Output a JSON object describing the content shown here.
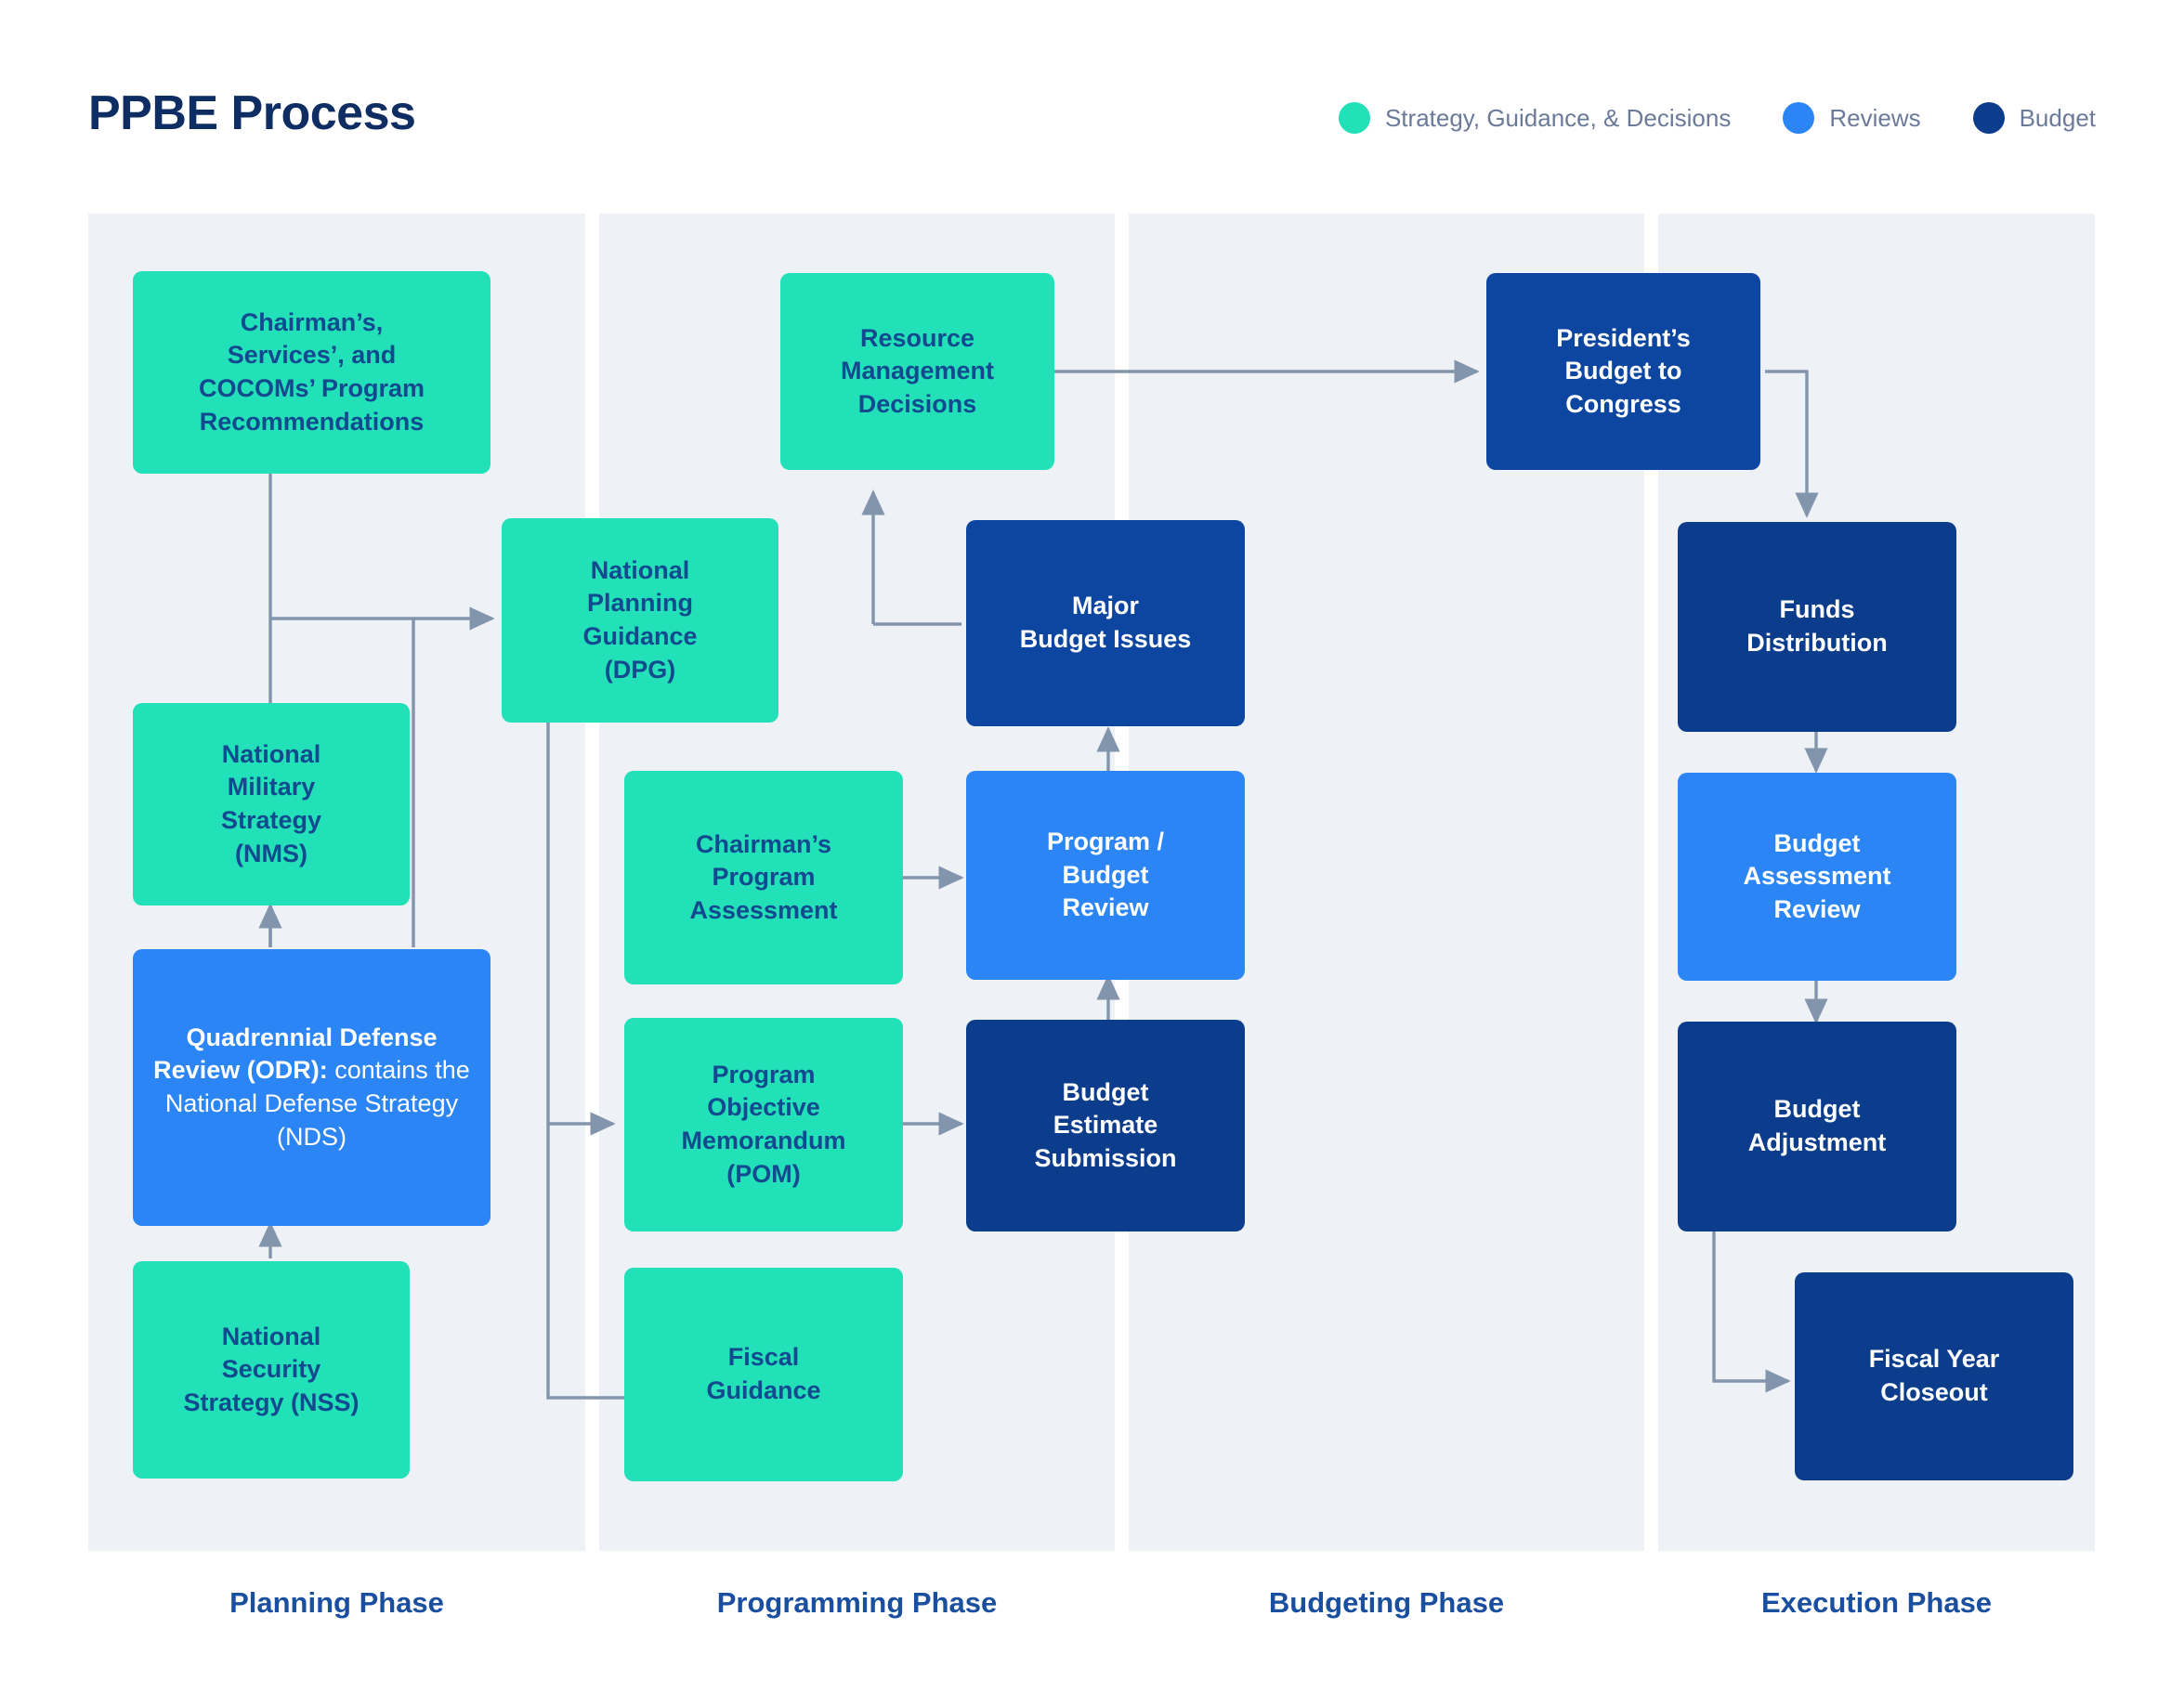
{
  "header": {
    "title": "PPBE Process",
    "legend": [
      {
        "label": "Strategy, Guidance, & Decisions",
        "color": "#22e0b8",
        "icon": "circle-icon"
      },
      {
        "label": "Reviews",
        "color": "#2b85f5",
        "icon": "circle-icon"
      },
      {
        "label": "Budget",
        "color": "#0b3d8c",
        "icon": "circle-icon"
      }
    ]
  },
  "phases": [
    {
      "label": "Planning Phase"
    },
    {
      "label": "Programming Phase"
    },
    {
      "label": "Budgeting Phase"
    },
    {
      "label": "Execution Phase"
    }
  ],
  "nodes": {
    "chairman_services_cocoms": "Chairman’s,\nServices’, and\nCOCOMs’ Program\nRecommendations",
    "national_military_strategy": "National\nMilitary\nStrategy\n(NMS)",
    "quadrennial_defense_review_bold": "Quadrennial Defense Review (ODR):",
    "quadrennial_defense_review_rest": " contains the National Defense Strategy (NDS)",
    "national_security_strategy": "National\nSecurity\nStrategy (NSS)",
    "national_planning_guidance": "National\nPlanning\nGuidance\n(DPG)",
    "resource_management_decisions": "Resource\nManagement\nDecisions",
    "chairmans_program_assessment": "Chairman’s\nProgram\nAssessment",
    "program_objective_memorandum": "Program\nObjective\nMemorandum\n(POM)",
    "fiscal_guidance": "Fiscal\nGuidance",
    "major_budget_issues": "Major\nBudget Issues",
    "program_budget_review": "Program /\nBudget\nReview",
    "budget_estimate_submission": "Budget\nEstimate\nSubmission",
    "presidents_budget_to_congress": "President’s\nBudget to\nCongress",
    "funds_distribution": "Funds\nDistribution",
    "budget_assessment_review": "Budget\nAssessment\nReview",
    "budget_adjustment": "Budget\nAdjustment",
    "fiscal_year_closeout": "Fiscal Year\nCloseout"
  },
  "colors": {
    "teal": "#22e0b8",
    "blue": "#2b85f5",
    "navy": "#0b3d8c",
    "navy_light": "#0c46a0",
    "panel": "#eef2f7",
    "connector": "#8394ad",
    "title": "#0d2d63",
    "phase_label": "#1a4fa0",
    "legend_text": "#6b7a99"
  }
}
